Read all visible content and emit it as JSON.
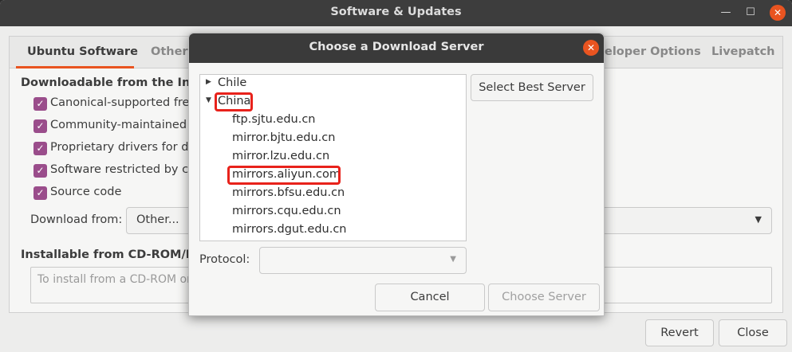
{
  "main_window": {
    "title": "Software & Updates",
    "tabs": [
      {
        "label": "Ubuntu Software"
      },
      {
        "label": "Other"
      },
      {
        "label": "eloper Options"
      },
      {
        "label": "Livepatch"
      }
    ],
    "downloadable_heading": "Downloadable from the Inter",
    "checkboxes": [
      {
        "label": "Canonical-supported free",
        "checked": true
      },
      {
        "label": "Community-maintained fre",
        "checked": true
      },
      {
        "label": "Proprietary drivers for dev",
        "checked": true
      },
      {
        "label": "Software restricted by cop",
        "checked": true
      },
      {
        "label": "Source code",
        "checked": true
      }
    ],
    "download_from_label": "Download from:",
    "download_from_value": "Other...",
    "installable_heading": "Installable from CD-ROM/DVD",
    "cdrom_text": "To install from a CD-ROM or D",
    "revert_label": "Revert",
    "close_label": "Close"
  },
  "dialog": {
    "title": "Choose a Download Server",
    "tree": [
      {
        "label": "Chile",
        "expander": "▶",
        "level": 0,
        "highlighted": false
      },
      {
        "label": "China",
        "expander": "▼",
        "level": 0,
        "highlighted": true
      },
      {
        "label": "ftp.sjtu.edu.cn",
        "expander": "",
        "level": 1,
        "highlighted": false
      },
      {
        "label": "mirror.bjtu.edu.cn",
        "expander": "",
        "level": 1,
        "highlighted": false
      },
      {
        "label": "mirror.lzu.edu.cn",
        "expander": "",
        "level": 1,
        "highlighted": false
      },
      {
        "label": "mirrors.aliyun.com",
        "expander": "",
        "level": 1,
        "highlighted": true
      },
      {
        "label": "mirrors.bfsu.edu.cn",
        "expander": "",
        "level": 1,
        "highlighted": false
      },
      {
        "label": "mirrors.cqu.edu.cn",
        "expander": "",
        "level": 1,
        "highlighted": false
      },
      {
        "label": "mirrors.dgut.edu.cn",
        "expander": "",
        "level": 1,
        "highlighted": false
      }
    ],
    "select_best_label": "Select Best Server",
    "protocol_label": "Protocol:",
    "protocol_value": "",
    "cancel_label": "Cancel",
    "choose_label": "Choose Server"
  },
  "icons": {
    "minimize": "minimize-icon",
    "maximize": "maximize-icon",
    "close": "close-icon",
    "dropdown": "chevron-down-icon"
  },
  "colors": {
    "accent": "#e95420",
    "checkbox": "#9a4d8b",
    "highlight_box": "#e8221b",
    "titlebar": "#3d3d3d"
  }
}
